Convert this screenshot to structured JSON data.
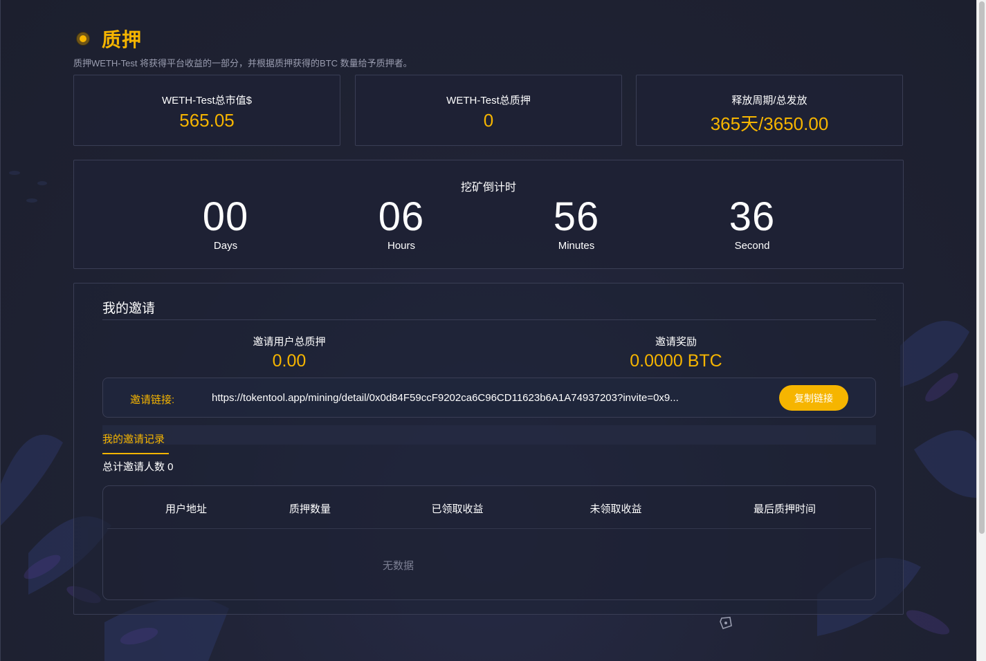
{
  "header": {
    "title": "质押",
    "subtitle": "质押WETH-Test 将获得平台收益的一部分，并根据质押获得的BTC 数量给予质押者。"
  },
  "stats": [
    {
      "label": "WETH-Test总市值$",
      "value": "565.05"
    },
    {
      "label": "WETH-Test总质押",
      "value": "0"
    },
    {
      "label": "释放周期/总发放",
      "value": "365天/3650.00"
    }
  ],
  "countdown": {
    "title": "挖矿倒计时",
    "units": [
      {
        "value": "00",
        "label": "Days"
      },
      {
        "value": "06",
        "label": "Hours"
      },
      {
        "value": "56",
        "label": "Minutes"
      },
      {
        "value": "36",
        "label": "Second"
      }
    ]
  },
  "invite": {
    "title": "我的邀请",
    "total_stake_label": "邀请用户总质押",
    "total_stake_value": "0.00",
    "reward_label": "邀请奖励",
    "reward_value": "0.0000 BTC",
    "link_label": "邀请链接:",
    "link_url": "https://tokentool.app/mining/detail/0x0d84F59ccF9202ca6C96CD11623b6A1A74937203?invite=0x9...",
    "copy_button": "复制链接",
    "records_tab": "我的邀请记录",
    "total_invites": "总计邀请人数 0",
    "table_headers": [
      "用户地址",
      "质押数量",
      "已领取收益",
      "未领取收益",
      "最后质押时间"
    ],
    "empty_text": "无数据"
  },
  "colors": {
    "accent": "#f6b500",
    "background": "#1f2233",
    "card": "#1e2234",
    "border": "#3a3e55"
  }
}
